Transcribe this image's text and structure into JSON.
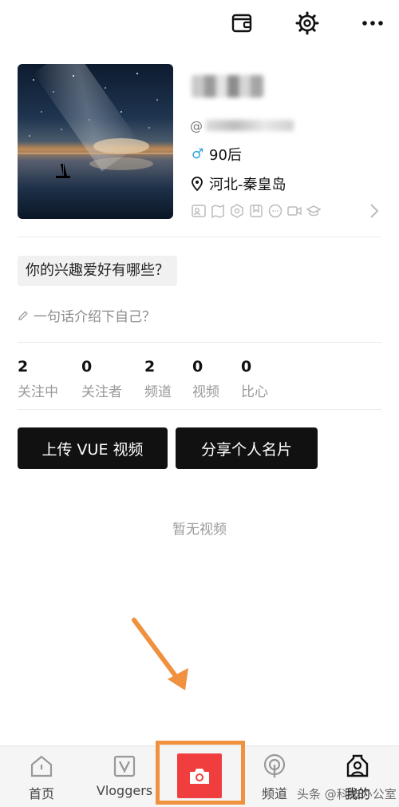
{
  "header": {
    "icons": [
      "wallet-icon",
      "settings-gear-icon",
      "more-dots-icon"
    ]
  },
  "profile": {
    "id_prefix": "@",
    "age_group": "90后",
    "gender_symbol": "♂",
    "location": "河北-秦皇岛",
    "badge_icons": [
      "id-card-icon",
      "map-icon",
      "hexagon-icon",
      "bookmark-icon",
      "chat-icon",
      "video-camera-icon",
      "graduation-cap-icon"
    ]
  },
  "interests": {
    "prompt": "你的兴趣爱好有哪些？"
  },
  "intro": {
    "placeholder": "一句话介绍下自己？"
  },
  "stats": [
    {
      "value": "2",
      "label": "关注中"
    },
    {
      "value": "0",
      "label": "关注者"
    },
    {
      "value": "2",
      "label": "频道"
    },
    {
      "value": "0",
      "label": "视频"
    },
    {
      "value": "0",
      "label": "比心"
    }
  ],
  "actions": {
    "upload_label": "上传 VUE 视频",
    "share_label": "分享个人名片"
  },
  "empty_state": "暂无视频",
  "bottom_nav": {
    "home": "首页",
    "vloggers": "Vloggers",
    "channels": "频道",
    "me": "我的"
  },
  "watermark": "头条 @科技办公室",
  "colors": {
    "accent_red": "#f03e3e",
    "annotation_orange": "#f0913f",
    "gender_blue": "#2fa3e0",
    "button_black": "#111111"
  }
}
